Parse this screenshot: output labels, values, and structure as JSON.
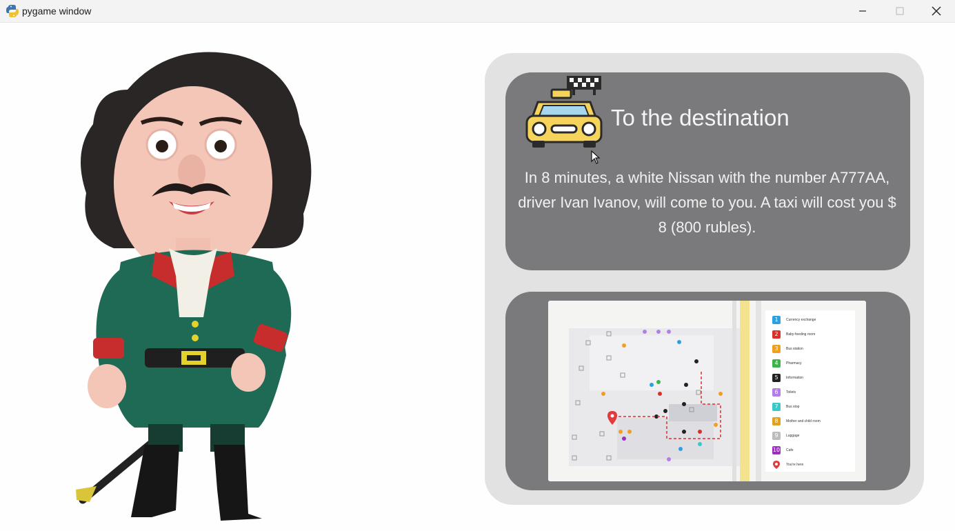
{
  "window": {
    "title": "pygame window",
    "controls": [
      "minimize",
      "maximize",
      "close"
    ]
  },
  "card": {
    "heading": "To the destination",
    "message": "In 8 minutes, a white Nissan with the number A777AA, driver Ivan Ivanov, will come to you. A taxi will cost you $ 8 (800 rubles)."
  },
  "map": {
    "legend": [
      {
        "num": "1",
        "color": "#2aa1e0",
        "label": "Currency exchange"
      },
      {
        "num": "2",
        "color": "#d9302a",
        "label": "Baby-feeding room"
      },
      {
        "num": "3",
        "color": "#f0a020",
        "label": "Bus station"
      },
      {
        "num": "4",
        "color": "#3cb44b",
        "label": "Pharmacy"
      },
      {
        "num": "5",
        "color": "#222222",
        "label": "Information"
      },
      {
        "num": "6",
        "color": "#b27ee8",
        "label": "Toilets"
      },
      {
        "num": "7",
        "color": "#38c9c9",
        "label": "Bus stop"
      },
      {
        "num": "8",
        "color": "#e0a020",
        "label": "Mother and child room"
      },
      {
        "num": "9",
        "color": "#bdbdbd",
        "label": "Luggage"
      },
      {
        "num": "10",
        "color": "#9b30c0",
        "label": "Cafe"
      },
      {
        "num": "",
        "color": "#e23b3b",
        "label": "You're here"
      }
    ]
  },
  "colors": {
    "card_bg": "#7a7a7c",
    "outer_bg": "#e2e2e2",
    "taxi_yellow": "#f6d35a"
  },
  "icons": {
    "app": "python-icon",
    "taxi": "taxi-icon",
    "pin": "location-pin-icon"
  }
}
